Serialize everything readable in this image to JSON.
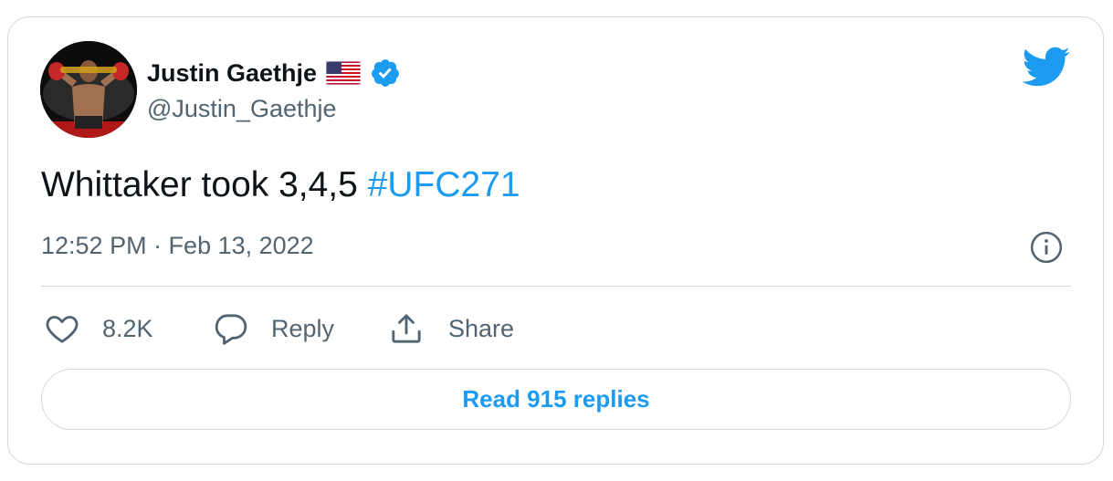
{
  "tweet": {
    "author_name": "Justin Gaethje",
    "author_handle": "@Justin_Gaethje",
    "flag_emoji": "us-flag-icon",
    "verified_icon": "verified-badge-icon",
    "text": "Whittaker took 3,4,5",
    "hashtag": "#UFC271",
    "timestamp": "12:52 PM · Feb 13, 2022"
  },
  "actions": {
    "like_count": "8.2K",
    "reply_label": "Reply",
    "share_label": "Share"
  },
  "footer": {
    "read_replies_label": "Read 915 replies"
  },
  "colors": {
    "accent": "#1d9bf0",
    "text_primary": "#0f1419",
    "text_secondary": "#536471",
    "border": "#cfd9de"
  }
}
